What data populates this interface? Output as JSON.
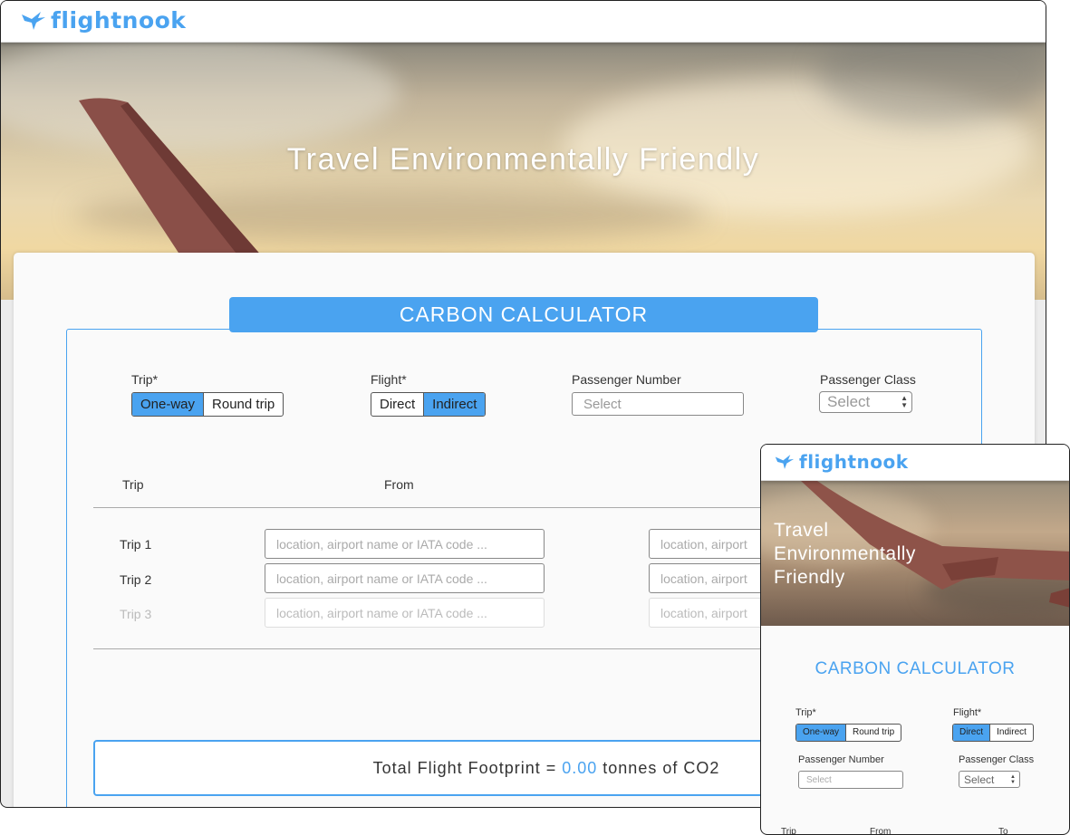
{
  "brand": {
    "name": "flightnook",
    "color": "#4aa3f0"
  },
  "hero": {
    "title": "Travel Environmentally Friendly"
  },
  "calculator": {
    "title": "CARBON CALCULATOR",
    "trip": {
      "label": "Trip*",
      "options": [
        "One-way",
        "Round trip"
      ],
      "selected": "One-way"
    },
    "flight": {
      "label": "Flight*",
      "options": [
        "Direct",
        "Indirect"
      ],
      "selected": "Indirect"
    },
    "passenger_number": {
      "label": "Passenger Number",
      "placeholder": "Select"
    },
    "passenger_class": {
      "label": "Passenger Class",
      "value": "Select"
    },
    "table": {
      "headers": {
        "trip": "Trip",
        "from": "From",
        "to": "To"
      },
      "rows": [
        {
          "label": "Trip 1",
          "from_placeholder": "location, airport name or IATA code ...",
          "to_placeholder": "location, airport"
        },
        {
          "label": "Trip 2",
          "from_placeholder": "location, airport name or IATA code ...",
          "to_placeholder": "location, airport"
        },
        {
          "label": "Trip 3",
          "from_placeholder": "location, airport name or IATA code ...",
          "to_placeholder": "location, airport"
        }
      ]
    },
    "total": {
      "prefix": "Total Flight Footprint =",
      "value": "0.00",
      "suffix": "tonnes of CO2"
    }
  },
  "mobile": {
    "hero_title": "Travel Environmentally Friendly",
    "calc_title": "CARBON CALCULATOR",
    "trip": {
      "label": "Trip*",
      "options": [
        "One-way",
        "Round trip"
      ],
      "selected": "One-way"
    },
    "flight": {
      "label": "Flight*",
      "options": [
        "Direct",
        "Indirect"
      ],
      "selected": "Direct"
    },
    "passenger_number": {
      "label": "Passenger Number",
      "placeholder": "Select"
    },
    "passenger_class": {
      "label": "Passenger Class",
      "value": "Select"
    },
    "headers": {
      "trip": "Trip",
      "from": "From",
      "to": "To"
    }
  }
}
